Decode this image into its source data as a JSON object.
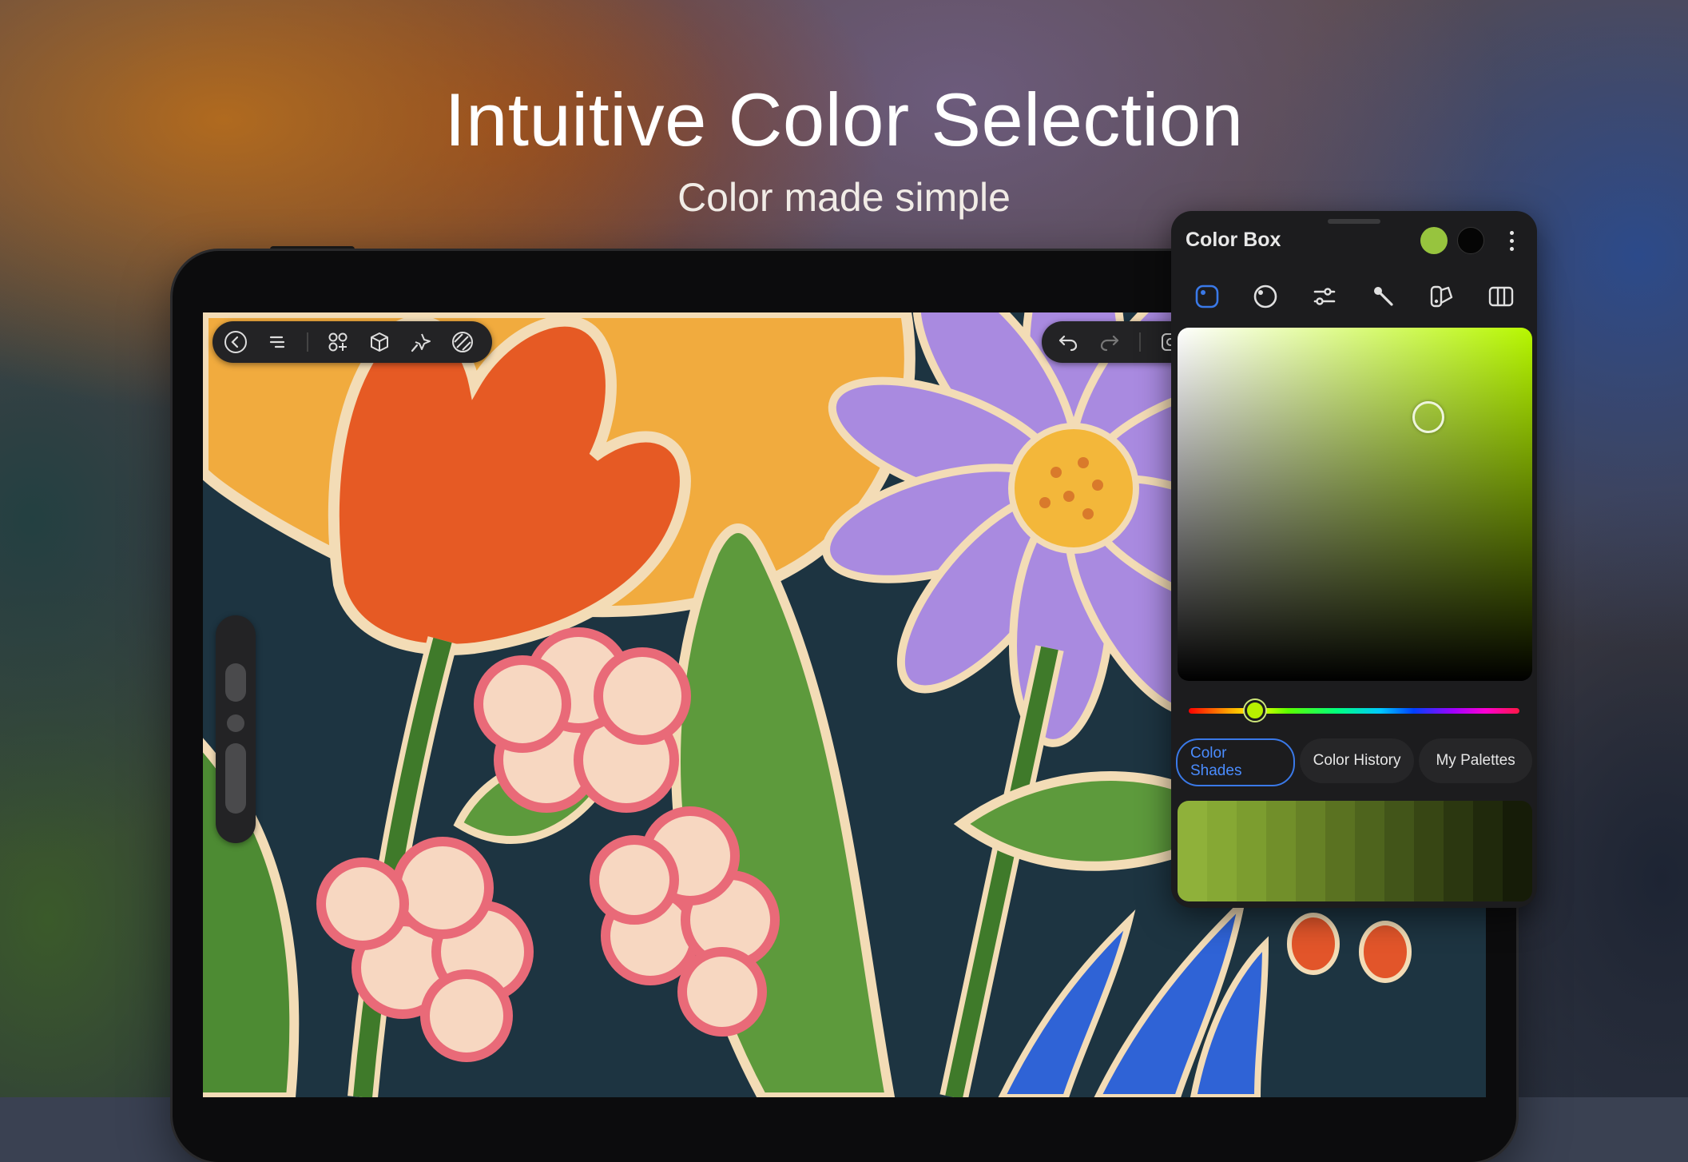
{
  "headline": {
    "title": "Intuitive Color Selection",
    "subtitle": "Color made simple"
  },
  "toolbar_left": {
    "icons": [
      "back-icon",
      "layers-menu-icon",
      "shapes-icon",
      "3d-cube-icon",
      "magic-wand-icon",
      "blend-icon"
    ]
  },
  "toolbar_right": {
    "icons": [
      "undo-icon",
      "redo-icon",
      "screenshot-icon"
    ]
  },
  "color_box": {
    "title": "Color Box",
    "primary_color": "#97c43e",
    "secondary_color": "#050505",
    "modes": [
      "color-disc-icon",
      "color-wheel-icon",
      "sliders-icon",
      "eyedropper-icon",
      "palette-icon",
      "split-panel-icon"
    ],
    "active_mode": 0,
    "hue_fraction": 0.2,
    "tabs": [
      "Color Shades",
      "Color History",
      "My Palettes"
    ],
    "active_tab": 0,
    "shades": [
      "#8fb13a",
      "#86a834",
      "#7c9d2f",
      "#718f2a",
      "#668126",
      "#5a7221",
      "#4e641d",
      "#425519",
      "#374614",
      "#2b3710",
      "#20290c",
      "#161c08"
    ]
  },
  "colors": {
    "accent": "#3a79e8",
    "panel_bg": "#1c1c1e"
  }
}
